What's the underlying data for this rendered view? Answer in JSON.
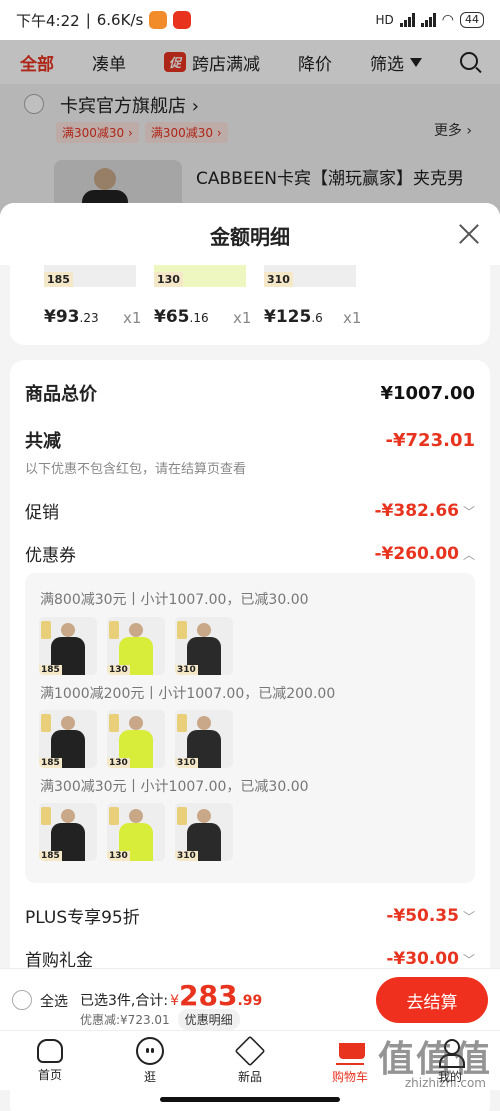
{
  "status_bar": {
    "time": "下午4:22",
    "speed": "6.6K/s",
    "battery": "44",
    "network": "HD"
  },
  "top_tabs": [
    {
      "label": "全部"
    },
    {
      "label": "凑单"
    },
    {
      "badge": "促",
      "label": "跨店满减"
    },
    {
      "label": "降价"
    },
    {
      "label": "筛选"
    }
  ],
  "background_store": {
    "name": "卡宾官方旗舰店",
    "promo_chips": [
      "满300减30",
      "满300减30"
    ],
    "more": "更多",
    "product_title": "CABBEEN卡宾【潮玩赢家】夹克男"
  },
  "sheet": {
    "title": "金额明细",
    "products": [
      {
        "badge": "185",
        "price_int": "¥93",
        "price_dec": ".23",
        "qty": "x1"
      },
      {
        "badge": "130",
        "price_int": "¥65",
        "price_dec": ".16",
        "qty": "x1"
      },
      {
        "badge": "310",
        "price_int": "¥125",
        "price_dec": ".6",
        "qty": "x1"
      }
    ],
    "total_label": "商品总价",
    "total_value": "¥1007.00",
    "reduce_label": "共减",
    "reduce_value": "-¥723.01",
    "reduce_note": "以下优惠不包含红包，请在结算页查看",
    "promo_label": "促销",
    "promo_value": "-¥382.66",
    "coupon_label": "优惠券",
    "coupon_value": "-¥260.00",
    "coupon_groups": [
      {
        "title": "满800减30元丨小计1007.00，已减30.00",
        "badges": [
          "185",
          "130",
          "310"
        ]
      },
      {
        "title": "满1000减200元丨小计1007.00，已减200.00",
        "badges": [
          "185",
          "130",
          "310"
        ]
      },
      {
        "title": "满300减30元丨小计1007.00，已减30.00",
        "badges": [
          "185",
          "130",
          "310"
        ]
      }
    ],
    "plus_label": "PLUS专享95折",
    "plus_value": "-¥50.35",
    "first_label": "首购礼金",
    "first_value": "-¥30.00"
  },
  "bottom_bar": {
    "select_all": "全选",
    "selected_text": "已选3件,合计:",
    "currency": "¥",
    "total_int": "283",
    "total_dec": ".99",
    "saved": "优惠减:¥723.01",
    "detail_chip": "优惠明细",
    "checkout": "去结算"
  },
  "tab_bar": [
    {
      "label": "首页",
      "icon": "home-icon"
    },
    {
      "label": "逛",
      "icon": "face-icon"
    },
    {
      "label": "新品",
      "icon": "box-icon"
    },
    {
      "label": "购物车",
      "icon": "cart-icon"
    },
    {
      "label": "我的",
      "icon": "user-icon"
    }
  ],
  "watermark": {
    "main": "值值值",
    "sub": "zhizhizhi.com"
  },
  "colors": {
    "accent": "#e8331f",
    "checkout": "#f0301f"
  }
}
